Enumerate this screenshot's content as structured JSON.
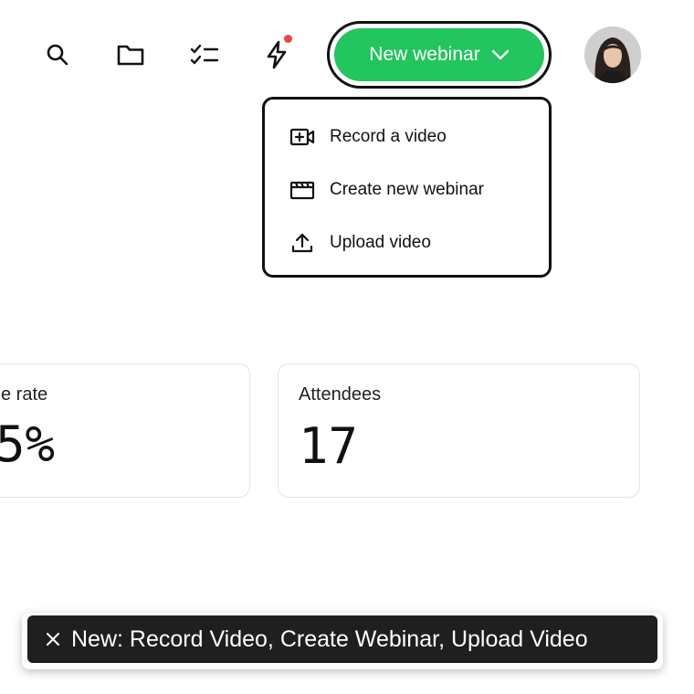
{
  "header": {
    "new_webinar_label": "New webinar",
    "accent_color": "#22c55e",
    "notification_color": "#ef4444",
    "icons": [
      "search-icon",
      "folder-icon",
      "checklist-icon",
      "lightning-icon",
      "chevron-down-icon"
    ]
  },
  "dropdown": {
    "items": [
      {
        "label": "Record a video",
        "icon": "video-plus-icon"
      },
      {
        "label": "Create new webinar",
        "icon": "clapperboard-icon"
      },
      {
        "label": "Upload video",
        "icon": "upload-icon"
      }
    ]
  },
  "stats": {
    "cards": [
      {
        "label": "e rate",
        "value": "5%"
      },
      {
        "label": "Attendees",
        "value": "17"
      }
    ]
  },
  "toast": {
    "text": "New: Record Video, Create Webinar, Upload Video",
    "icon": "close-icon"
  }
}
